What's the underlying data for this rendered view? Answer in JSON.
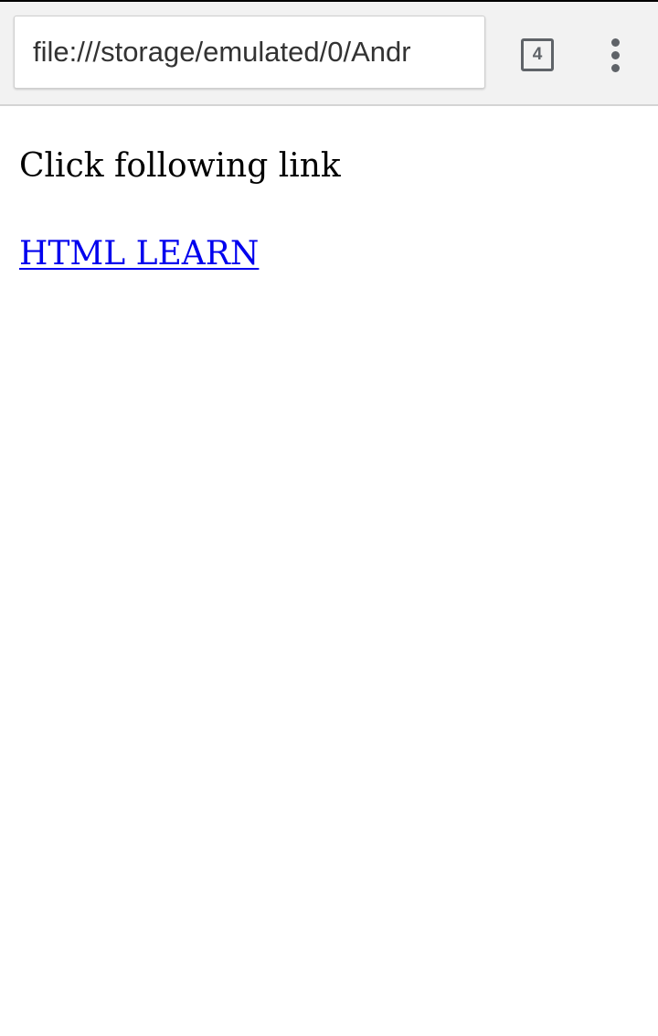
{
  "browser": {
    "url": "file:///storage/emulated/0/Andr",
    "tab_count": "4",
    "tab_icon": "tab-switcher-icon",
    "menu_icon": "more-vertical-icon"
  },
  "page": {
    "paragraph": "Click following link",
    "link_text": "HTML LEARN"
  },
  "colors": {
    "toolbar_bg": "#f2f2f2",
    "link": "#0000ee",
    "icon": "#5f6368"
  }
}
